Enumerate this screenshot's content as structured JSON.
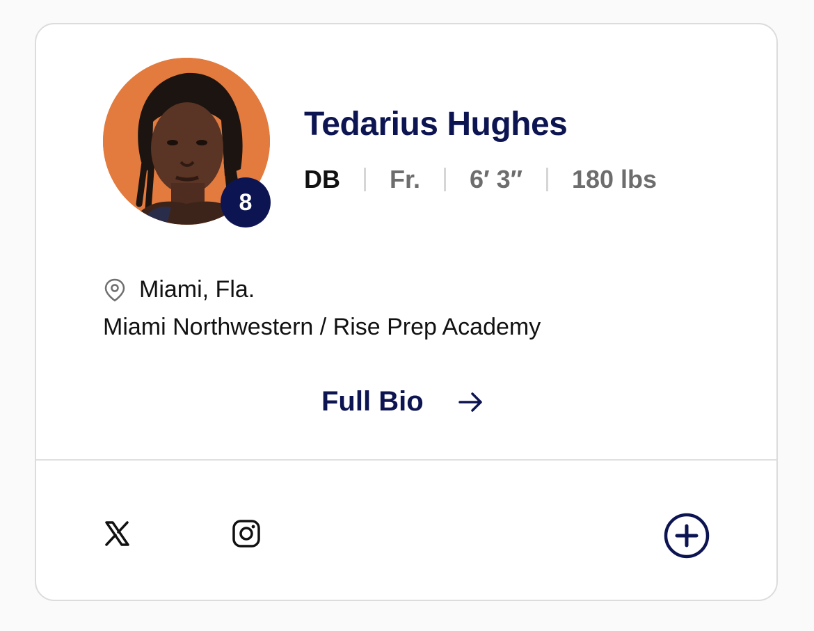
{
  "player": {
    "name": "Tedarius Hughes",
    "number": "8",
    "position": "DB",
    "class_year": "Fr.",
    "height": "6′ 3″",
    "weight": "180 lbs",
    "hometown": "Miami, Fla.",
    "school": "Miami Northwestern / Rise Prep Academy"
  },
  "links": {
    "full_bio_label": "Full Bio"
  },
  "icons": {
    "location": "map-pin-icon",
    "bio_arrow": "arrow-right-icon",
    "social": [
      "x-icon",
      "instagram-icon"
    ],
    "action": "plus-circle-icon"
  },
  "colors": {
    "brand_navy": "#0d1452",
    "avatar_background": "#e37a3e",
    "meta_gray": "#6d6d6d"
  }
}
